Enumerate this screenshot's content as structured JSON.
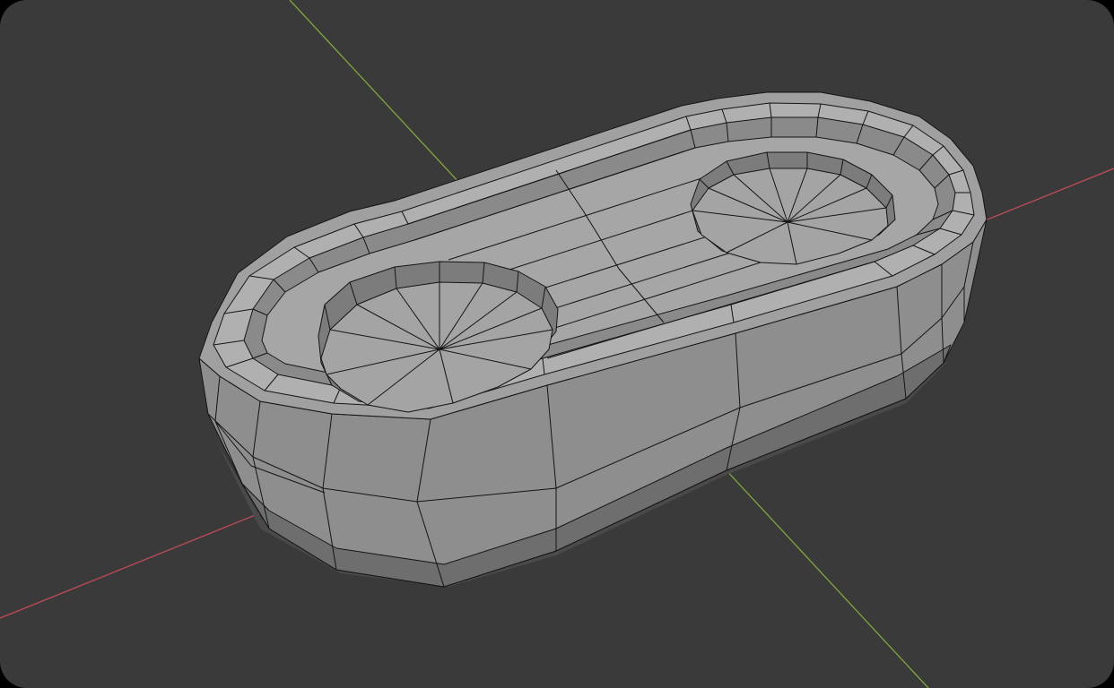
{
  "viewport": {
    "background": "#3a3a3a",
    "axes": {
      "x_color": "#c04b58",
      "y_color": "#7fa83a"
    }
  },
  "mesh": {
    "name": "rounded-tray-with-two-circular-wells",
    "shading": {
      "top_face": "#a8a8a8",
      "wall_light": "#9a9a9a",
      "wall_mid": "#8c8c8c",
      "wall_dark": "#5c5c5c",
      "well_floor": "#a3a3a3",
      "well_wall": "#7a7a7a",
      "wireframe": "#141414"
    }
  }
}
